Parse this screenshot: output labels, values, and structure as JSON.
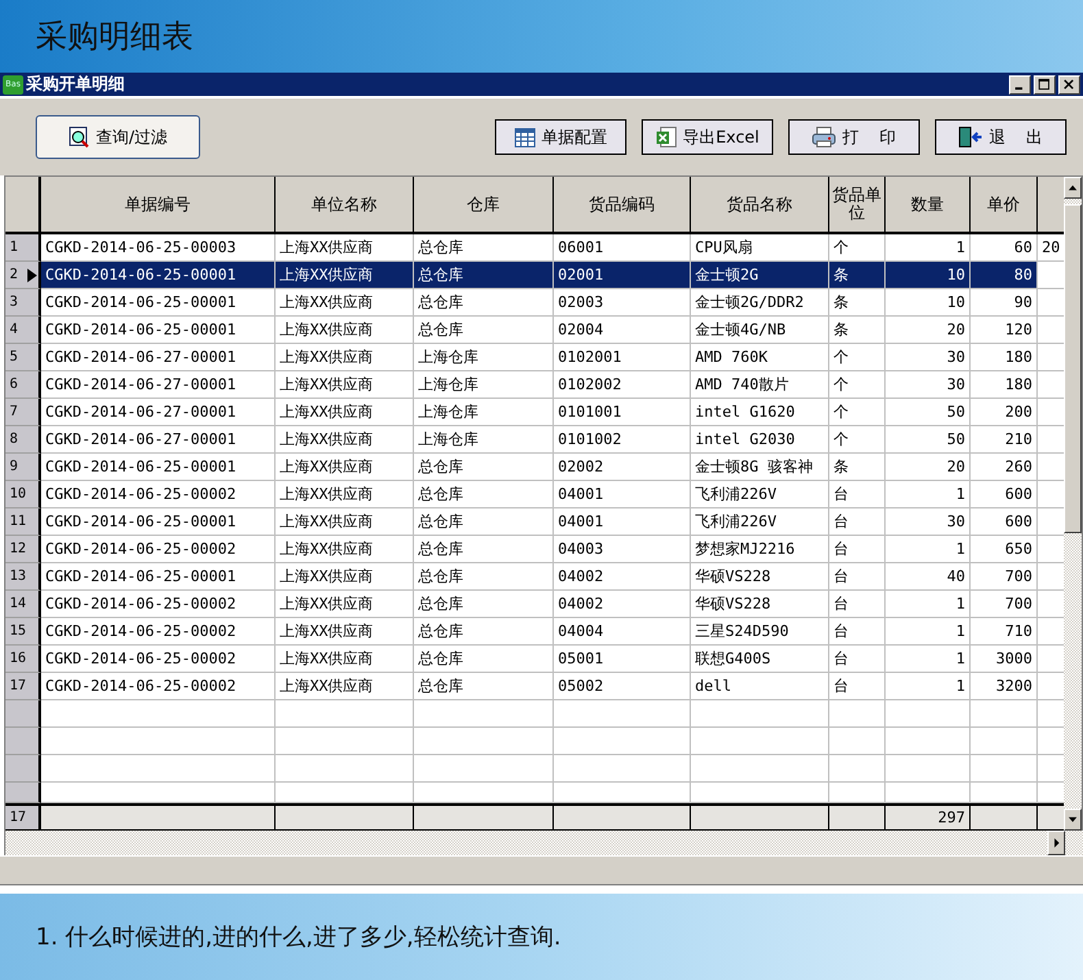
{
  "page_title": "采购明细表",
  "window": {
    "title": "采购开单明细",
    "app_badge": "Bas"
  },
  "toolbar": [
    {
      "kind": "search",
      "label": "查询/过滤"
    },
    {
      "kind": "grid",
      "label": "单据配置"
    },
    {
      "kind": "excel",
      "label": "导出Excel"
    },
    {
      "kind": "print",
      "label": "打    印"
    },
    {
      "kind": "exit",
      "label": "退    出"
    }
  ],
  "table": {
    "columns": [
      "单据编号",
      "单位名称",
      "仓库",
      "货品编码",
      "货品名称",
      "货品单位",
      "数量",
      "单价"
    ],
    "rows": [
      {
        "num": "1",
        "selected": false,
        "cells": [
          "CGKD-2014-06-25-00003",
          "上海XX供应商",
          "总仓库",
          "06001",
          "CPU风扇",
          "个",
          "1",
          "60",
          "20"
        ]
      },
      {
        "num": "2",
        "selected": true,
        "cells": [
          "CGKD-2014-06-25-00001",
          "上海XX供应商",
          "总仓库",
          "02001",
          "金士顿2G",
          "条",
          "10",
          "80"
        ]
      },
      {
        "num": "3",
        "selected": false,
        "cells": [
          "CGKD-2014-06-25-00001",
          "上海XX供应商",
          "总仓库",
          "02003",
          "金士顿2G/DDR2",
          "条",
          "10",
          "90"
        ]
      },
      {
        "num": "4",
        "selected": false,
        "cells": [
          "CGKD-2014-06-25-00001",
          "上海XX供应商",
          "总仓库",
          "02004",
          "金士顿4G/NB",
          "条",
          "20",
          "120"
        ]
      },
      {
        "num": "5",
        "selected": false,
        "cells": [
          "CGKD-2014-06-27-00001",
          "上海XX供应商",
          "上海仓库",
          "0102001",
          "AMD 760K",
          "个",
          "30",
          "180"
        ]
      },
      {
        "num": "6",
        "selected": false,
        "cells": [
          "CGKD-2014-06-27-00001",
          "上海XX供应商",
          "上海仓库",
          "0102002",
          "AMD 740散片",
          "个",
          "30",
          "180"
        ]
      },
      {
        "num": "7",
        "selected": false,
        "cells": [
          "CGKD-2014-06-27-00001",
          "上海XX供应商",
          "上海仓库",
          "0101001",
          "intel G1620",
          "个",
          "50",
          "200"
        ]
      },
      {
        "num": "8",
        "selected": false,
        "cells": [
          "CGKD-2014-06-27-00001",
          "上海XX供应商",
          "上海仓库",
          "0101002",
          "intel G2030",
          "个",
          "50",
          "210"
        ]
      },
      {
        "num": "9",
        "selected": false,
        "cells": [
          "CGKD-2014-06-25-00001",
          "上海XX供应商",
          "总仓库",
          "02002",
          "金士顿8G 骇客神",
          "条",
          "20",
          "260"
        ]
      },
      {
        "num": "10",
        "selected": false,
        "cells": [
          "CGKD-2014-06-25-00002",
          "上海XX供应商",
          "总仓库",
          "04001",
          "飞利浦226V",
          "台",
          "1",
          "600"
        ]
      },
      {
        "num": "11",
        "selected": false,
        "cells": [
          "CGKD-2014-06-25-00001",
          "上海XX供应商",
          "总仓库",
          "04001",
          "飞利浦226V",
          "台",
          "30",
          "600"
        ]
      },
      {
        "num": "12",
        "selected": false,
        "cells": [
          "CGKD-2014-06-25-00002",
          "上海XX供应商",
          "总仓库",
          "04003",
          "梦想家MJ2216",
          "台",
          "1",
          "650"
        ]
      },
      {
        "num": "13",
        "selected": false,
        "cells": [
          "CGKD-2014-06-25-00001",
          "上海XX供应商",
          "总仓库",
          "04002",
          "华硕VS228",
          "台",
          "40",
          "700"
        ]
      },
      {
        "num": "14",
        "selected": false,
        "cells": [
          "CGKD-2014-06-25-00002",
          "上海XX供应商",
          "总仓库",
          "04002",
          "华硕VS228",
          "台",
          "1",
          "700"
        ]
      },
      {
        "num": "15",
        "selected": false,
        "cells": [
          "CGKD-2014-06-25-00002",
          "上海XX供应商",
          "总仓库",
          "04004",
          "三星S24D590",
          "台",
          "1",
          "710"
        ]
      },
      {
        "num": "16",
        "selected": false,
        "cells": [
          "CGKD-2014-06-25-00002",
          "上海XX供应商",
          "总仓库",
          "05001",
          "联想G400S",
          "台",
          "1",
          "3000"
        ]
      },
      {
        "num": "17",
        "selected": false,
        "cells": [
          "CGKD-2014-06-25-00002",
          "上海XX供应商",
          "总仓库",
          "05002",
          "dell",
          "台",
          "1",
          "3200"
        ]
      }
    ],
    "footer": {
      "count": "17",
      "quantity_total": "297"
    }
  },
  "caption": "1. 什么时候进的,进的什么,进了多少,轻松统计查询."
}
